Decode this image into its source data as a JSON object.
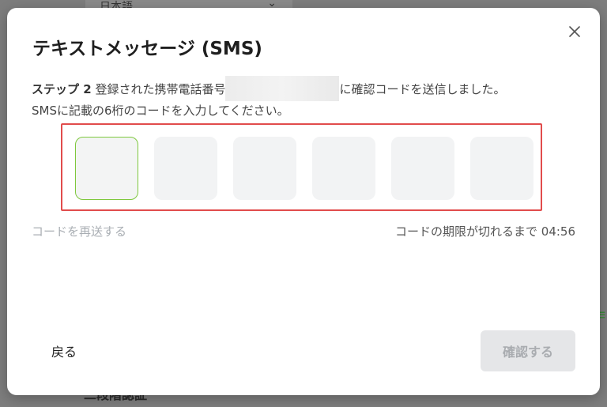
{
  "background": {
    "language_select": "日本語",
    "bottom_text": "二段階認証"
  },
  "modal": {
    "title": "テキストメッセージ (SMS)",
    "step_label": "ステップ 2",
    "desc_before": " 登録された携帯電話番号",
    "desc_after": "に確認コードを送信しました。",
    "desc_line2": "SMSに記載の6桁のコードを入力してください。",
    "code_cells": [
      "",
      "",
      "",
      "",
      "",
      ""
    ],
    "resend_label": "コードを再送する",
    "expiry_text": "コードの期限が切れるまで 04:56",
    "back_label": "戻る",
    "confirm_label": "確認する",
    "colors": {
      "active_border": "#7ec83e",
      "highlight_frame": "#e14c4c"
    }
  }
}
